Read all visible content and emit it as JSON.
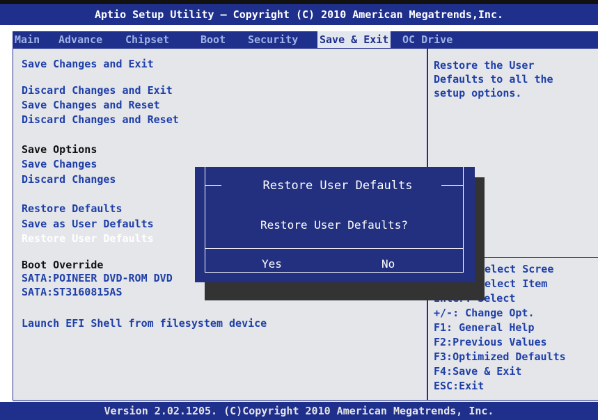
{
  "title": "Aptio Setup Utility – Copyright (C) 2010 American Megatrends,Inc.",
  "tabs": [
    {
      "label": "Main",
      "active": false
    },
    {
      "label": "Advance",
      "active": false
    },
    {
      "label": "Chipset",
      "active": false
    },
    {
      "label": "Boot",
      "active": false
    },
    {
      "label": "Security",
      "active": false
    },
    {
      "label": "Save & Exit",
      "active": true
    },
    {
      "label": "OC Drive",
      "active": false
    }
  ],
  "menu": {
    "save_changes_and_exit": "Save Changes and Exit",
    "discard_changes_and_exit": "Discard Changes and Exit",
    "save_changes_and_reset": "Save Changes and Reset",
    "discard_changes_and_reset": "Discard Changes and Reset",
    "save_options_header": "Save Options",
    "save_changes": "Save Changes",
    "discard_changes": "Discard Changes",
    "restore_defaults": "Restore Defaults",
    "save_as_user_defaults": "Save as User Defaults",
    "restore_user_defaults": "Restore User Defaults",
    "boot_override_header": "Boot Override",
    "sata_dvd": "SATA:POINEER DVD-ROM DVD",
    "sata_hdd": "SATA:ST3160815AS",
    "launch_efi_shell": "Launch EFI Shell from filesystem device"
  },
  "help": {
    "description": "Restore the User\nDefaults to all the\nsetup options.",
    "keys": [
      "Select Scree",
      "Select Item",
      "Enter: Select",
      "+/-:  Change Opt.",
      "F1: General Help",
      "F2:Previous Values",
      "F3:Optimized Defaults",
      "F4:Save & Exit",
      "ESC:Exit"
    ]
  },
  "dialog": {
    "title": "Restore User Defaults",
    "message": "Restore User Defaults?",
    "yes_label": "Yes",
    "no_label": "No"
  },
  "footer": "Version 2.02.1205. (C)Copyright 2010 American Megatrends, Inc.",
  "colors": {
    "bios_blue": "#1f2f8c",
    "panel_gray": "#e4e6ea",
    "menu_text": "#1f3fa8"
  }
}
